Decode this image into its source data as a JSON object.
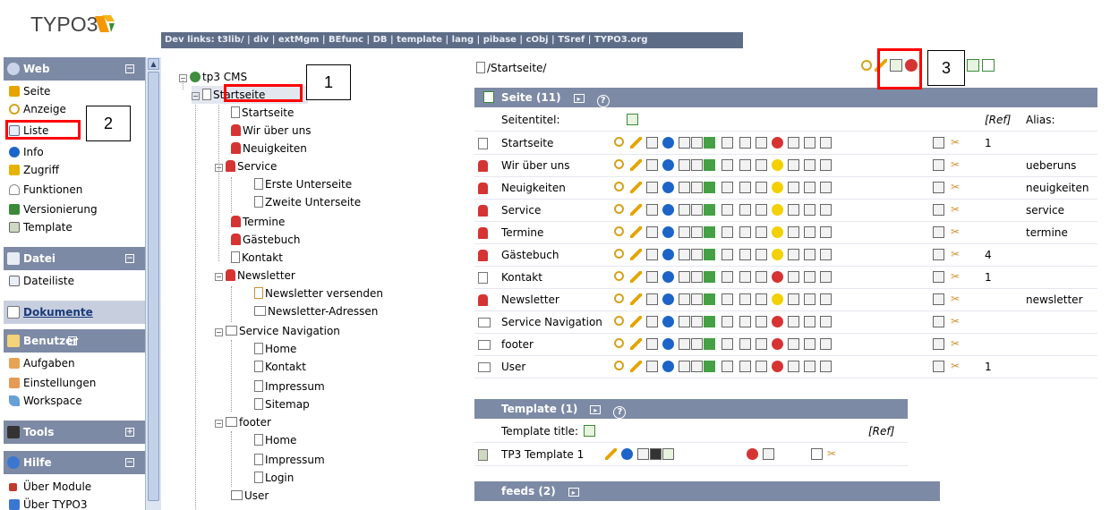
{
  "logo": {
    "text": "TYPO3"
  },
  "devlinks": "Dev links: t3lib/ | div | extMgm | BEfunc | DB | template | lang | pibase | cObj | TSref | TYPO3.org",
  "modules": {
    "web": {
      "label": "Web",
      "toggle": "⊟",
      "items": [
        "Seite",
        "Anzeige",
        "Liste",
        "Info",
        "Zugriff",
        "Funktionen",
        "Versionierung",
        "Template"
      ]
    },
    "datei": {
      "label": "Datei",
      "toggle": "⊟",
      "items": [
        "Dateiliste"
      ]
    },
    "dokumente": {
      "label": "Dokumente"
    },
    "benutzer": {
      "label": "Benutzer",
      "toggle": "⊟",
      "items": [
        "Aufgaben",
        "Einstellungen",
        "Workspace"
      ]
    },
    "tools": {
      "label": "Tools",
      "toggle": "⊞"
    },
    "hilfe": {
      "label": "Hilfe",
      "toggle": "⊟",
      "items": [
        "Über Module",
        "Über TYPO3"
      ]
    }
  },
  "tree": {
    "root": "tp3 CMS",
    "nodes": [
      "Startseite",
      "Startseite",
      "Wir über uns",
      "Neuigkeiten",
      "Service",
      "Erste Unterseite",
      "Zweite Unterseite",
      "Termine",
      "Gästebuch",
      "Kontakt",
      "Newsletter",
      "Newsletter versenden",
      "Newsletter-Adressen",
      "Service Navigation",
      "Home",
      "Kontakt",
      "Impressum",
      "Sitemap",
      "footer",
      "Home",
      "Impressum",
      "Login",
      "User"
    ]
  },
  "path": "/Startseite/",
  "seite_table": {
    "title": "Seite (11)",
    "col_title": "Seitentitel:",
    "col_ref": "[Ref]",
    "col_alias": "Alias:",
    "rows": [
      {
        "title": "Startseite",
        "ref": "1",
        "alias": "",
        "type": "p"
      },
      {
        "title": "Wir über uns",
        "ref": "",
        "alias": "ueberuns",
        "type": "r"
      },
      {
        "title": "Neuigkeiten",
        "ref": "",
        "alias": "neuigkeiten",
        "type": "r"
      },
      {
        "title": "Service",
        "ref": "",
        "alias": "service",
        "type": "r"
      },
      {
        "title": "Termine",
        "ref": "",
        "alias": "termine",
        "type": "r"
      },
      {
        "title": "Gästebuch",
        "ref": "4",
        "alias": "",
        "type": "r"
      },
      {
        "title": "Kontakt",
        "ref": "1",
        "alias": "",
        "type": "p"
      },
      {
        "title": "Newsletter",
        "ref": "",
        "alias": "newsletter",
        "type": "r"
      },
      {
        "title": "Service Navigation",
        "ref": "",
        "alias": "",
        "type": "f"
      },
      {
        "title": "footer",
        "ref": "",
        "alias": "",
        "type": "f"
      },
      {
        "title": "User",
        "ref": "1",
        "alias": "",
        "type": "f"
      }
    ]
  },
  "template_table": {
    "title": "Template (1)",
    "col_title": "Template title:",
    "col_ref": "[Ref]",
    "row_title": "TP3 Template 1"
  },
  "feeds_table": {
    "title": "feeds (2)"
  },
  "annotations": [
    "1",
    "2",
    "3"
  ]
}
